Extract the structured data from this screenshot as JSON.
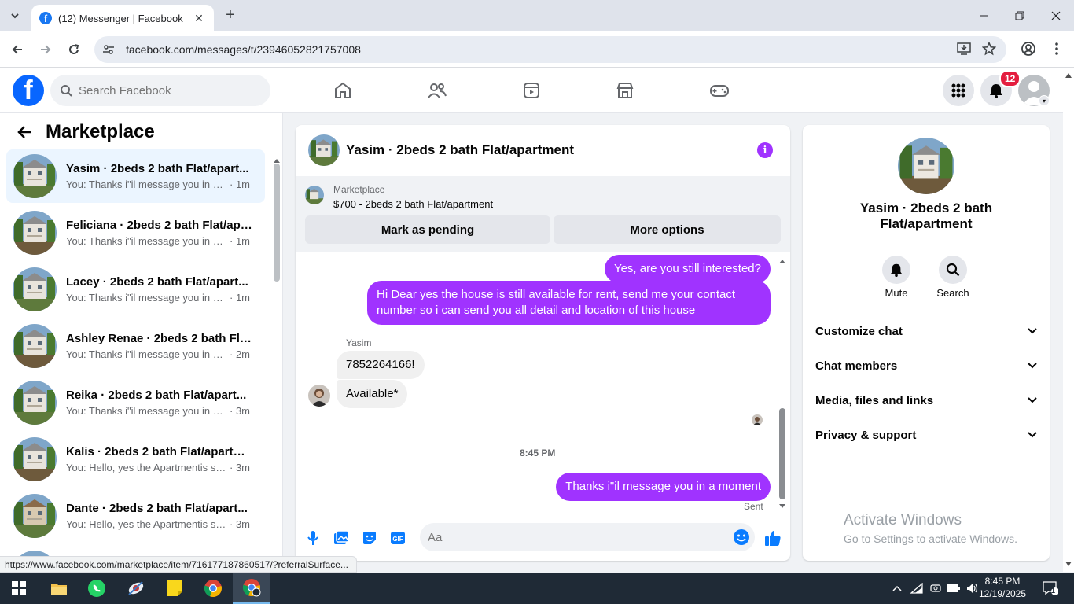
{
  "browser": {
    "tab_title": "(12) Messenger | Facebook",
    "url": "facebook.com/messages/t/23946052821757008",
    "status_url": "https://www.facebook.com/marketplace/item/716177187860517/?referralSurface..."
  },
  "fb_header": {
    "logo_letter": "f",
    "search_placeholder": "Search Facebook",
    "notification_count": "12"
  },
  "left_panel": {
    "title": "Marketplace",
    "conversations": [
      {
        "name": "Yasim · 2beds 2 bath Flat/apart...",
        "preview": "You: Thanks i\"il message you in a ...",
        "time": "· 1m"
      },
      {
        "name": "Feliciana · 2beds 2 bath Flat/apa...",
        "preview": "You: Thanks i\"il message you in a ...",
        "time": "· 1m"
      },
      {
        "name": "Lacey · 2beds 2 bath Flat/apart...",
        "preview": "You: Thanks i\"il message you in a ...",
        "time": "· 1m"
      },
      {
        "name": "Ashley Renae · 2beds 2 bath Flat...",
        "preview": "You: Thanks i\"il message you in a ...",
        "time": "· 2m"
      },
      {
        "name": "Reika · 2beds 2 bath Flat/apart...",
        "preview": "You: Thanks i\"il message you in a ...",
        "time": "· 3m"
      },
      {
        "name": "Kalis · 2beds 2 bath Flat/apartm...",
        "preview": "You: Hello, yes the Apartmentis stil...",
        "time": "· 3m"
      },
      {
        "name": "Dante · 2beds 2 bath Flat/apart...",
        "preview": "You: Hello, yes the Apartmentis stil...",
        "time": "· 3m"
      }
    ]
  },
  "chat": {
    "header_name": "Yasim · 2beds 2 bath Flat/apartment",
    "marketplace_label": "Marketplace",
    "listing_title": "$700 - 2beds 2 bath Flat/apartment",
    "mark_pending_label": "Mark as pending",
    "more_options_label": "More options",
    "messages": {
      "out1": "Yes, are you still interested?",
      "out2": "Hi Dear yes the house is still available for rent, send me your contact number so i can send you all detail and location of this house",
      "sender": "Yasim",
      "in1": "7852264166!",
      "in2": "Available*",
      "timestamp": "8:45 PM",
      "out3": "Thanks i\"il message you in a moment",
      "status": "Sent"
    },
    "composer_placeholder": "Aa",
    "gif_label": "GIF"
  },
  "right_panel": {
    "name": "Yasim · 2beds 2 bath Flat/apartment",
    "mute_label": "Mute",
    "search_label": "Search",
    "sections": [
      "Customize chat",
      "Chat members",
      "Media, files and links",
      "Privacy & support"
    ]
  },
  "watermark": {
    "line1": "Activate Windows",
    "line2": "Go to Settings to activate Windows."
  },
  "taskbar": {
    "time": "8:45 PM",
    "date": "12/19/2025",
    "notification_count": "1"
  },
  "colors": {
    "accent_purple": "#a033ff",
    "fb_blue": "#0866ff"
  }
}
